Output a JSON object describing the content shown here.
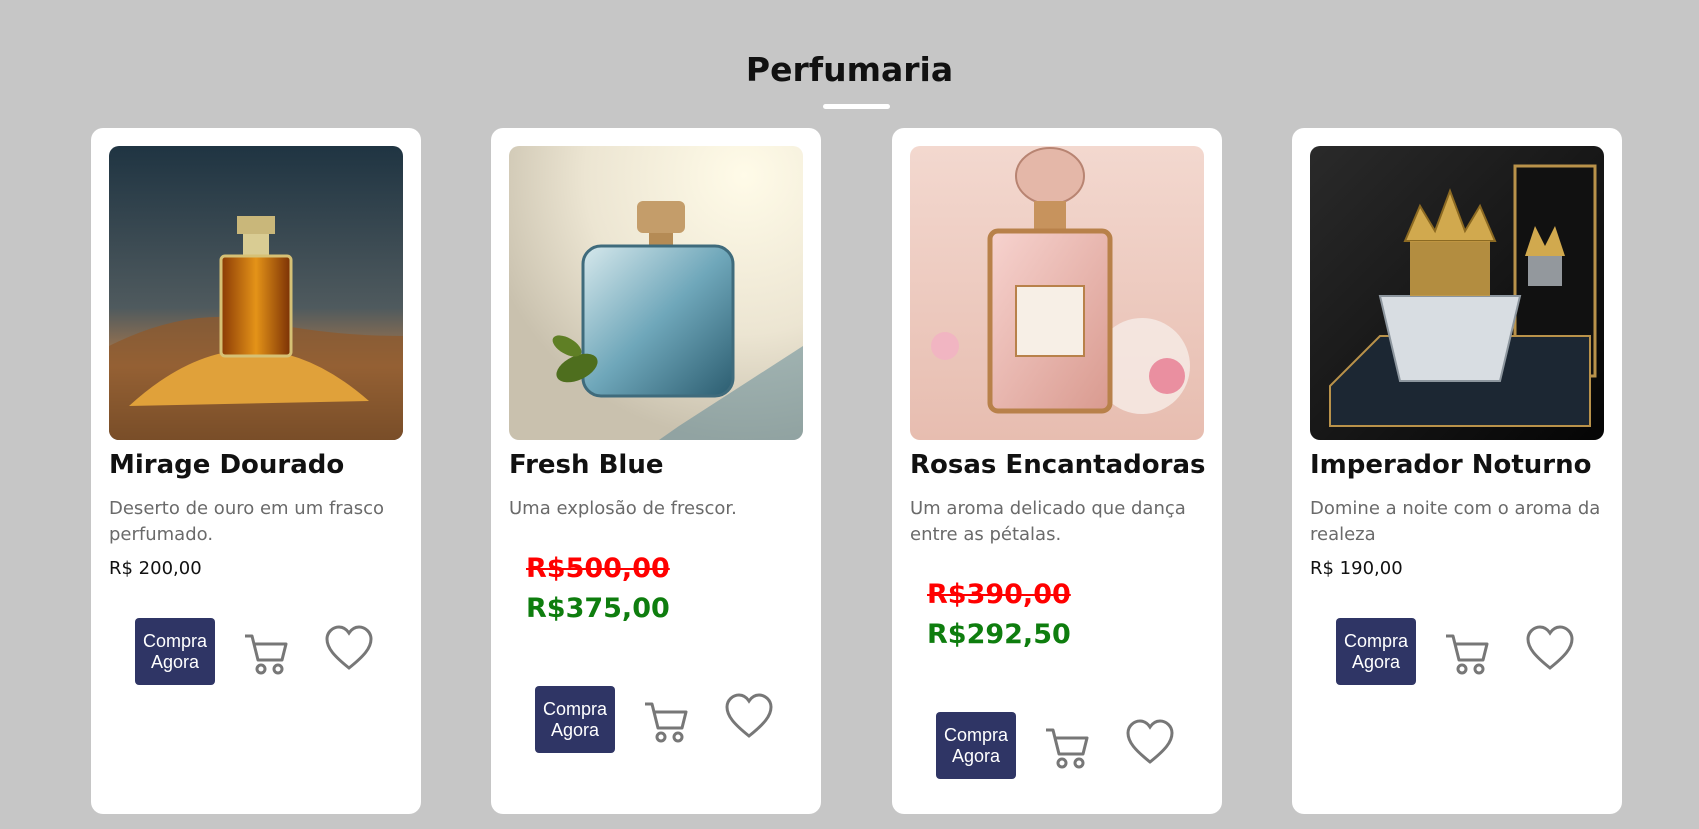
{
  "section": {
    "title": "Perfumaria"
  },
  "colors": {
    "background": "#c6c6c6",
    "button": "#2f3565",
    "old_price": "#ff0000",
    "new_price": "#0e7d0e"
  },
  "products": [
    {
      "name": "Mirage Dourado",
      "description": "Deserto de ouro em um frasco perfumado.",
      "price": "R$ 200,00",
      "buy_label": "Compra Agora",
      "cart_icon": "cart-icon",
      "favorite_icon": "heart-icon"
    },
    {
      "name": "Fresh Blue",
      "description": "Uma explosão de frescor.",
      "old_price": "R$500,00",
      "new_price": "R$375,00",
      "buy_label": "Compra Agora",
      "cart_icon": "cart-icon",
      "favorite_icon": "heart-icon"
    },
    {
      "name": "Rosas Encantadoras",
      "description": "Um aroma delicado que dança entre as pétalas.",
      "old_price": "R$390,00",
      "new_price": "R$292,50",
      "buy_label": "Compra Agora",
      "cart_icon": "cart-icon",
      "favorite_icon": "heart-icon"
    },
    {
      "name": "Imperador Noturno",
      "description": "Domine a noite com o aroma da realeza",
      "price": "R$ 190,00",
      "buy_label": "Compra Agora",
      "cart_icon": "cart-icon",
      "favorite_icon": "heart-icon"
    }
  ]
}
